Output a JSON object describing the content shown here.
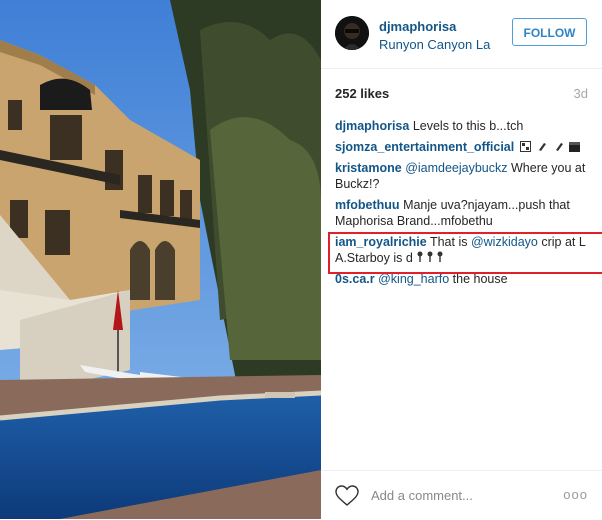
{
  "header": {
    "username": "djmaphorisa",
    "location": "Runyon Canyon La",
    "follow_label": "FOLLOW"
  },
  "stats": {
    "likes": "252 likes",
    "age": "3d"
  },
  "comments": [
    {
      "user": "djmaphorisa",
      "text": "Levels to this b...tch"
    },
    {
      "user": "sjomza_entertainment_official",
      "text": ""
    },
    {
      "user": "kristamone",
      "mention": "@iamdeejaybuckz",
      "text": " Where you at Buckz!?"
    },
    {
      "user": "mfobethuu",
      "text": "Manje uva?njayam...push that Maphorisa Brand...mfobethu"
    },
    {
      "user": "iam_royalrichie",
      "text_before": "That is ",
      "mention": "@wizkidayo",
      "text_after": " crip at L A.Starboy is d "
    },
    {
      "user": "0s.ca.r",
      "mention": "@king_harfo",
      "text": " the house"
    }
  ],
  "add_comment": {
    "placeholder": "Add a comment...",
    "more_label": "ooo"
  },
  "colors": {
    "link_blue": "#125688",
    "follow_blue": "#2e84c6",
    "highlight_red": "#e0202a"
  },
  "icons": [
    "heart-icon",
    "more-options-icon",
    "avatar-image"
  ]
}
